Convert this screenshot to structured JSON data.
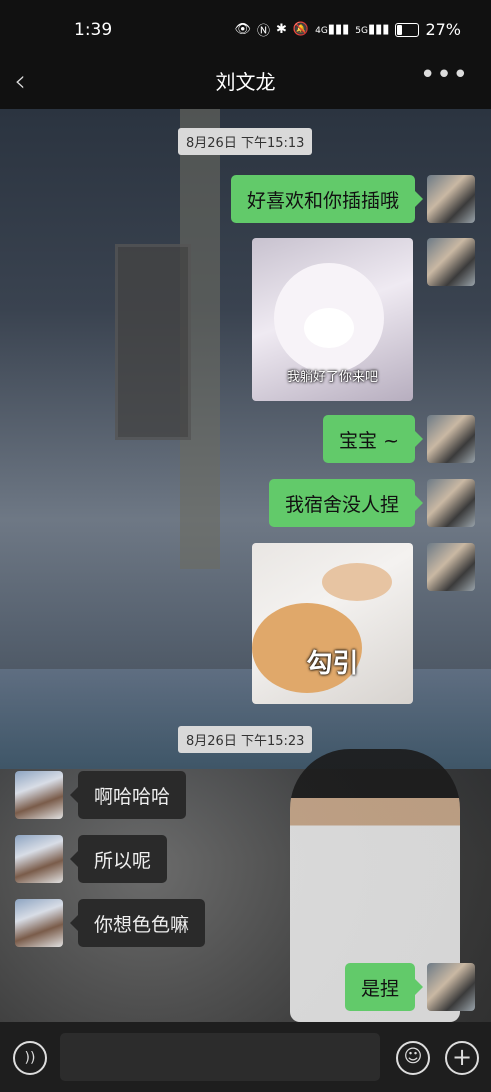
{
  "status_bar": {
    "time": "1:39",
    "icons": [
      "eye-icon",
      "nfc-icon",
      "bluetooth-icon",
      "mute-icon",
      "4g-signal-icon",
      "5g-signal-icon",
      "battery-icon"
    ],
    "net1": "4G",
    "net2": "5G",
    "battery_percent": "27%",
    "battery_level": 0.27
  },
  "header": {
    "back_icon": "chevron-left-icon",
    "title": "刘文龙",
    "more_icon": "more-dots-icon"
  },
  "messages": [
    {
      "type": "timestamp",
      "text": "8月26日 下午15:13"
    },
    {
      "type": "text",
      "sender": "me",
      "text": "好喜欢和你插插哦"
    },
    {
      "type": "sticker",
      "sender": "me",
      "caption": "我躺好了你来吧"
    },
    {
      "type": "text",
      "sender": "me",
      "text": "宝宝 ~"
    },
    {
      "type": "text",
      "sender": "me",
      "text": "我宿舍没人捏"
    },
    {
      "type": "sticker",
      "sender": "me",
      "caption": "勾引"
    },
    {
      "type": "timestamp",
      "text": "8月26日 下午15:23"
    },
    {
      "type": "text",
      "sender": "other",
      "text": "啊哈哈哈"
    },
    {
      "type": "text",
      "sender": "other",
      "text": "所以呢"
    },
    {
      "type": "text",
      "sender": "other",
      "text": "你想色色嘛"
    },
    {
      "type": "text",
      "sender": "me",
      "text": "是捏"
    }
  ],
  "input_bar": {
    "voice_icon": "voice-icon",
    "placeholder": "",
    "emoji_icon": "emoji-icon",
    "plus_icon": "plus-icon"
  },
  "colors": {
    "my_bubble": "#62ca6a",
    "their_bubble": "#2a2a2a",
    "timestamp_bg": "#d9d9d9"
  }
}
